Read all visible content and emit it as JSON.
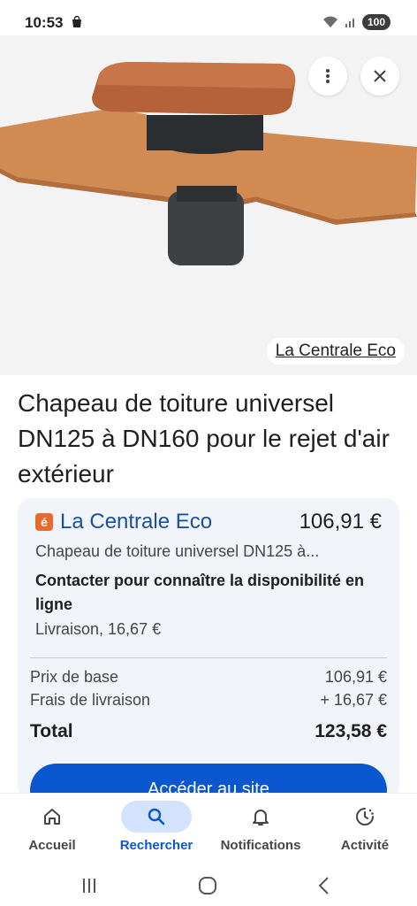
{
  "status_bar": {
    "time": "10:53",
    "battery": "100"
  },
  "hero": {
    "source_label": "La Centrale Eco"
  },
  "product": {
    "title": "Chapeau de toiture universel DN125 à DN160 pour le rejet d'air extérieur"
  },
  "offer": {
    "merchant_logo": "é",
    "merchant": "La Centrale Eco",
    "price": "106,91 €",
    "short_title": "Chapeau de toiture universel DN125 à...",
    "availability": "Contacter pour connaître la disponibilité en ligne",
    "delivery": "Livraison, 16,67 €",
    "breakdown": {
      "base_label": "Prix de base",
      "base_value": "106,91 €",
      "shipping_label": "Frais de livraison",
      "shipping_value": "+ 16,67 €",
      "total_label": "Total",
      "total_value": "123,58 €"
    },
    "cta_label": "Accéder au site"
  },
  "nav": {
    "items": [
      {
        "label": "Accueil",
        "icon": "home-icon"
      },
      {
        "label": "Rechercher",
        "icon": "search-icon",
        "active": true
      },
      {
        "label": "Notifications",
        "icon": "bell-icon"
      },
      {
        "label": "Activité",
        "icon": "activity-icon"
      }
    ]
  },
  "colors": {
    "accent": "#0b57d0",
    "merchant_link": "#1a4fa3",
    "active_pill": "#d3e3fd",
    "card_bg": "#f1f4f9"
  }
}
